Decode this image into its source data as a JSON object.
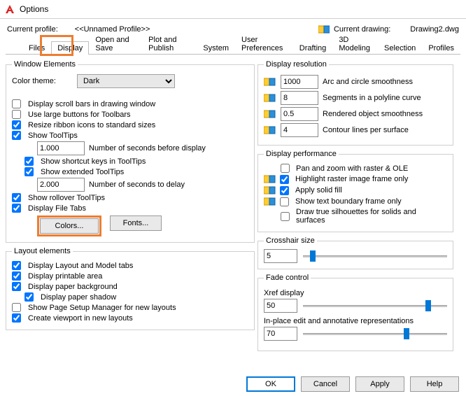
{
  "window": {
    "title": "Options"
  },
  "profile": {
    "label": "Current profile:",
    "value": "<<Unnamed Profile>>",
    "drawing_label": "Current drawing:",
    "drawing_value": "Drawing2.dwg"
  },
  "tabs": {
    "items": [
      {
        "label": "Files"
      },
      {
        "label": "Display"
      },
      {
        "label": "Open and Save"
      },
      {
        "label": "Plot and Publish"
      },
      {
        "label": "System"
      },
      {
        "label": "User Preferences"
      },
      {
        "label": "Drafting"
      },
      {
        "label": "3D Modeling"
      },
      {
        "label": "Selection"
      },
      {
        "label": "Profiles"
      }
    ],
    "active_index": 1
  },
  "window_elements": {
    "legend": "Window Elements",
    "color_theme_label": "Color theme:",
    "color_theme_value": "Dark",
    "scroll_bars": {
      "label": "Display scroll bars in drawing window",
      "checked": false
    },
    "large_buttons": {
      "label": "Use large buttons for Toolbars",
      "checked": false
    },
    "resize_ribbon": {
      "label": "Resize ribbon icons to standard sizes",
      "checked": true
    },
    "show_tooltips": {
      "label": "Show ToolTips",
      "checked": true
    },
    "seconds_before": {
      "value": "1.000",
      "label": "Number of seconds before display"
    },
    "shortcut_keys": {
      "label": "Show shortcut keys in ToolTips",
      "checked": true
    },
    "extended_tt": {
      "label": "Show extended ToolTips",
      "checked": true
    },
    "seconds_delay": {
      "value": "2.000",
      "label": "Number of seconds to delay"
    },
    "rollover_tt": {
      "label": "Show rollover ToolTips",
      "checked": true
    },
    "file_tabs": {
      "label": "Display File Tabs",
      "checked": true
    },
    "colors_btn": "Colors...",
    "fonts_btn": "Fonts..."
  },
  "layout_elements": {
    "legend": "Layout elements",
    "layout_tabs": {
      "label": "Display Layout and Model tabs",
      "checked": true
    },
    "printable_area": {
      "label": "Display printable area",
      "checked": true
    },
    "paper_bg": {
      "label": "Display paper background",
      "checked": true
    },
    "paper_shadow": {
      "label": "Display paper shadow",
      "checked": true
    },
    "page_setup": {
      "label": "Show Page Setup Manager for new layouts",
      "checked": false
    },
    "create_viewport": {
      "label": "Create viewport in new layouts",
      "checked": true
    }
  },
  "display_resolution": {
    "legend": "Display resolution",
    "rows": [
      {
        "value": "1000",
        "label": "Arc and circle smoothness"
      },
      {
        "value": "8",
        "label": "Segments in a polyline curve"
      },
      {
        "value": "0.5",
        "label": "Rendered object smoothness"
      },
      {
        "value": "4",
        "label": "Contour lines per surface"
      }
    ]
  },
  "display_performance": {
    "legend": "Display performance",
    "pan_zoom": {
      "label": "Pan and zoom with raster & OLE",
      "checked": false
    },
    "highlight_raster": {
      "label": "Highlight raster image frame only",
      "checked": true
    },
    "solid_fill": {
      "label": "Apply solid fill",
      "checked": true
    },
    "text_boundary": {
      "label": "Show text boundary frame only",
      "checked": false
    },
    "true_silhouettes": {
      "label": "Draw true silhouettes for solids and surfaces",
      "checked": false
    }
  },
  "crosshair": {
    "legend": "Crosshair size",
    "value": "5",
    "percent": 5
  },
  "fade": {
    "legend": "Fade control",
    "xref_label": "Xref display",
    "xref_value": "50",
    "xref_percent": 85,
    "inplace_label": "In-place edit and annotative representations",
    "inplace_value": "70",
    "inplace_percent": 70
  },
  "footer": {
    "ok": "OK",
    "cancel": "Cancel",
    "apply": "Apply",
    "help": "Help"
  }
}
